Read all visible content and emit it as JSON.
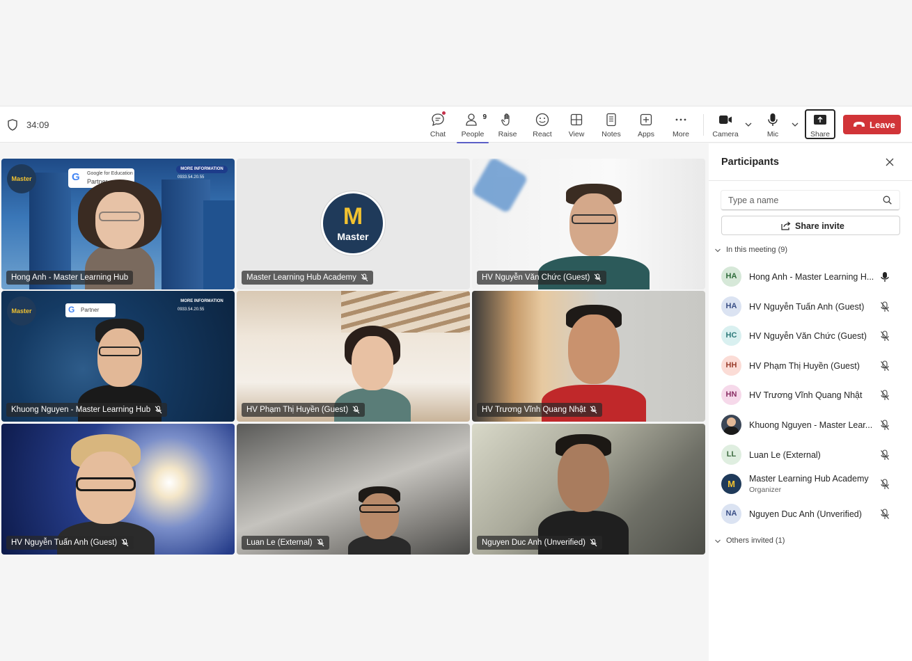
{
  "meeting": {
    "timer": "34:09"
  },
  "toolbar": {
    "chat": "Chat",
    "people": "People",
    "people_count": "9",
    "raise": "Raise",
    "react": "React",
    "view": "View",
    "notes": "Notes",
    "apps": "Apps",
    "more": "More",
    "camera": "Camera",
    "mic": "Mic",
    "share": "Share",
    "leave": "Leave"
  },
  "tiles": [
    {
      "name": "Hong Anh - Master Learning Hub",
      "muted": false
    },
    {
      "name": "Master Learning Hub Academy",
      "muted": true,
      "logo_text": "Master"
    },
    {
      "name": "HV Nguyễn Văn Chức (Guest)",
      "muted": true
    },
    {
      "name": "Khuong Nguyen - Master Learning Hub",
      "muted": true
    },
    {
      "name": "HV Phạm Thị Huyền (Guest)",
      "muted": true
    },
    {
      "name": "HV Trương Vĩnh Quang Nhật",
      "muted": true
    },
    {
      "name": "HV Nguyễn Tuấn Anh (Guest)",
      "muted": true
    },
    {
      "name": "Luan Le (External)",
      "muted": true
    },
    {
      "name": "Nguyen Duc Anh (Unverified)",
      "muted": true
    }
  ],
  "backgrounds": {
    "more_information": "MORE INFORMATION",
    "google_partner_line1": "Google for Education",
    "google_partner_line2": "Partner",
    "phone": "0933.54.20.55",
    "logo_text": "Master"
  },
  "panel": {
    "title": "Participants",
    "search_placeholder": "Type a name",
    "share_invite": "Share invite",
    "in_meeting": "In this meeting (9)",
    "others_invited": "Others invited (1)",
    "participants": [
      {
        "initials": "HA",
        "name": "Hong Anh - Master Learning H...",
        "role": "",
        "avatar_bg": "#d6e8d8",
        "avatar_fg": "#2e6b3a",
        "mic": "on"
      },
      {
        "initials": "HA",
        "name": "HV Nguyễn Tuấn Anh (Guest)",
        "role": "",
        "avatar_bg": "#dbe3f2",
        "avatar_fg": "#3a4f86",
        "mic": "off"
      },
      {
        "initials": "HC",
        "name": "HV Nguyễn Văn Chức (Guest)",
        "role": "",
        "avatar_bg": "#d9f0f0",
        "avatar_fg": "#2d7a7a",
        "mic": "off"
      },
      {
        "initials": "HH",
        "name": "HV Phạm Thị Huyền (Guest)",
        "role": "",
        "avatar_bg": "#fbdcd6",
        "avatar_fg": "#9a3d2c",
        "mic": "off"
      },
      {
        "initials": "HN",
        "name": "HV Trương Vĩnh Quang Nhật",
        "role": "",
        "avatar_bg": "#f6d9ea",
        "avatar_fg": "#8a2e64",
        "mic": "off"
      },
      {
        "initials": "",
        "name": "Khuong Nguyen - Master Lear...",
        "role": "",
        "avatar_bg": "#3b4656",
        "avatar_fg": "#ffffff",
        "mic": "off"
      },
      {
        "initials": "LL",
        "name": "Luan Le (External)",
        "role": "",
        "avatar_bg": "#dfeee0",
        "avatar_fg": "#3d6b40",
        "mic": "off"
      },
      {
        "initials": "",
        "name": "Master Learning Hub Academy",
        "role": "Organizer",
        "avatar_bg": "#1f3a5a",
        "avatar_fg": "#f2c230",
        "mic": "off"
      },
      {
        "initials": "NA",
        "name": "Nguyen Duc Anh (Unverified)",
        "role": "",
        "avatar_bg": "#dbe3f2",
        "avatar_fg": "#3a4f86",
        "mic": "off"
      }
    ]
  },
  "colors": {
    "accent": "#5b5fc7",
    "leave": "#d13438",
    "notification": "#c4314b"
  }
}
